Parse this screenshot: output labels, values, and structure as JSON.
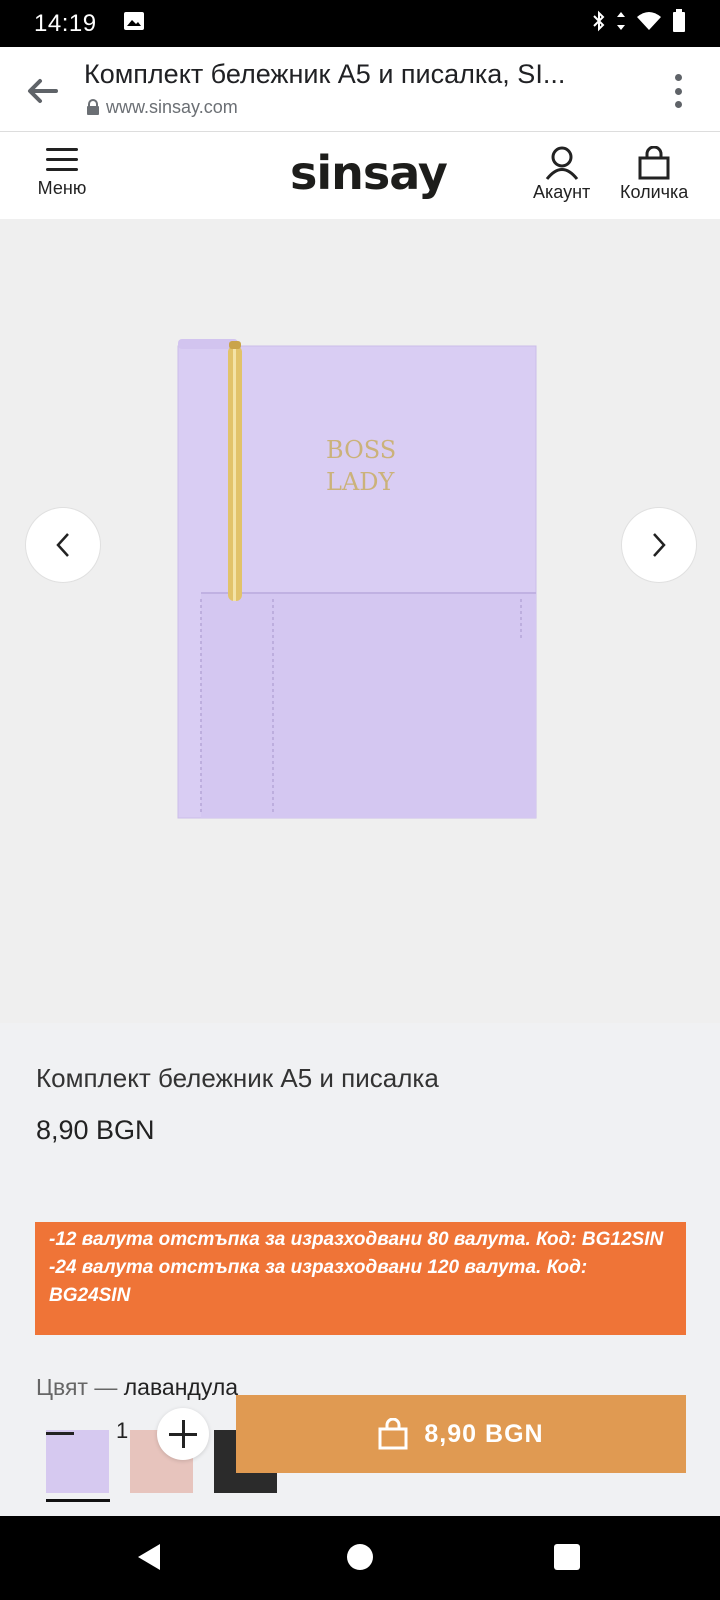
{
  "status_bar": {
    "time": "14:19"
  },
  "browser": {
    "page_title": "Комплект бележник А5 и писалка, SI...",
    "url_host": "www.sinsay.com"
  },
  "header": {
    "menu_label": "Меню",
    "logo_text": "sinsay",
    "account_label": "Акаунт",
    "cart_label": "Количка"
  },
  "gallery": {
    "cover_text_line1": "BOSS",
    "cover_text_line2": "LADY"
  },
  "product": {
    "name": "Комплект бележник А5 и писалка",
    "price": "8,90 BGN"
  },
  "promo": {
    "line1": "-12 валута отстъпка за изразходвани 80 валута. Код: BG12SIN",
    "line2": "-24 валута отстъпка за изразходвани 120 валута. Код: BG24SIN"
  },
  "color": {
    "label": "Цвят —",
    "value": "лавандула",
    "swatches": [
      "#d6c9f0",
      "#e7c4bd",
      "#2b2b2b"
    ]
  },
  "quantity": {
    "value": "1"
  },
  "add_to_cart": {
    "label": "8,90 BGN"
  },
  "colors": {
    "promo_bg": "#ef7437",
    "button_bg": "#e09a52",
    "notebook": "#d9cdf3"
  }
}
